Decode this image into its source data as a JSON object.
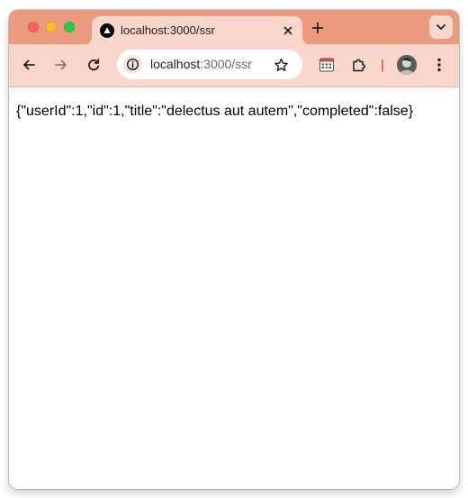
{
  "browser": {
    "tab": {
      "title": "localhost:3000/ssr",
      "favicon": "nextjs-triangle-icon"
    },
    "address_bar": {
      "host": "localhost",
      "path": ":3000/ssr"
    },
    "colors": {
      "tabstrip": "#ea9a7e",
      "toolbar": "#f9d6cb",
      "accent_divider": "#e0745f"
    },
    "icons": [
      "back-arrow-icon",
      "forward-arrow-icon",
      "reload-icon",
      "site-info-icon",
      "bookmark-star-icon",
      "extension-app-icon",
      "puzzle-extensions-icon",
      "profile-avatar-icon",
      "kebab-menu-icon",
      "tab-search-chevron-icon",
      "new-tab-plus-icon",
      "close-icon"
    ]
  },
  "page": {
    "body_text": "{\"userId\":1,\"id\":1,\"title\":\"delectus aut autem\",\"completed\":false}"
  }
}
